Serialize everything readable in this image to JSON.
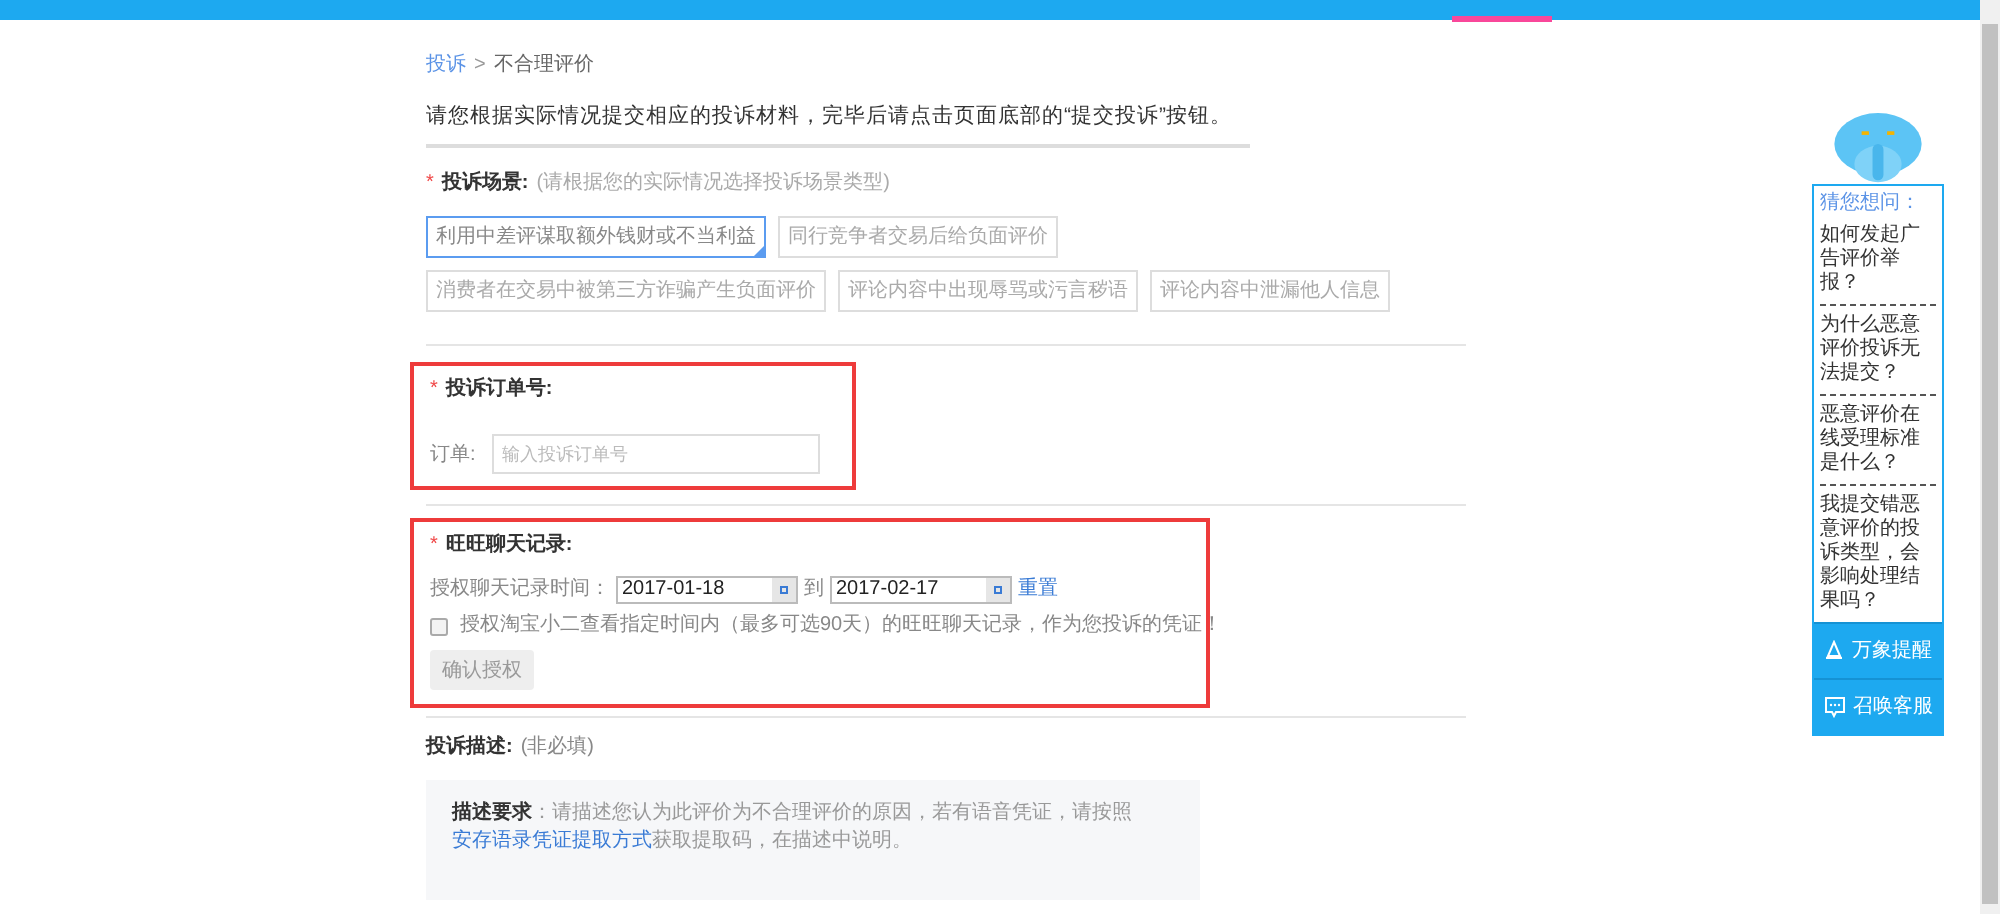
{
  "breadcrumb": {
    "link": "投诉",
    "separator": ">",
    "current": "不合理评价"
  },
  "instruction": "请您根据实际情况提交相应的投诉材料，完毕后请点击页面底部的“提交投诉”按钮。",
  "scenario": {
    "marker": "*",
    "label": "投诉场景:",
    "hint": "(请根据您的实际情况选择投诉场景类型)",
    "options": [
      {
        "label": "利用中差评谋取额外钱财或不当利益",
        "selected": true
      },
      {
        "label": "同行竞争者交易后给负面评价",
        "selected": false
      },
      {
        "label": "消费者在交易中被第三方诈骗产生负面评价",
        "selected": false
      },
      {
        "label": "评论内容中出现辱骂或污言秽语",
        "selected": false
      },
      {
        "label": "评论内容中泄漏他人信息",
        "selected": false
      }
    ]
  },
  "order": {
    "marker": "*",
    "highlighted": true,
    "label": "投诉订单号:",
    "field_label": "订单:",
    "placeholder": "输入投诉订单号"
  },
  "chat": {
    "marker": "*",
    "highlighted": true,
    "label": "旺旺聊天记录:",
    "range_label": "授权聊天记录时间：",
    "start": "2017-01-18",
    "to": "到",
    "end": "2017-02-17",
    "reset": "重置",
    "consent": {
      "label": "授权淘宝小二查看指定时间内（最多可选90天）的旺旺聊天记录，作为您投诉的凭证！",
      "checked": false
    },
    "confirm": {
      "label": "确认授权",
      "disabled": true
    }
  },
  "description": {
    "label": "投诉描述:",
    "hint": "(非必填)",
    "req_label": "描述要求",
    "req_text": "：请描述您认为此评价为不合理评价的原因，若有语音凭证，请按照",
    "link": "安存语录凭证提取方式",
    "req_tail": "获取提取码，在描述中说明。"
  },
  "helper": {
    "title": "猜您想问：",
    "questions": [
      "如何发起广告评价举报？",
      "为什么恶意评价投诉无法提交？",
      "恶意评价在线受理标准是什么？",
      "我提交错恶意评价的投诉类型，会影响处理结果吗？"
    ],
    "actions": [
      {
        "kind": "bell",
        "label": "万象提醒"
      },
      {
        "kind": "chat",
        "label": "召唤客服"
      }
    ]
  }
}
